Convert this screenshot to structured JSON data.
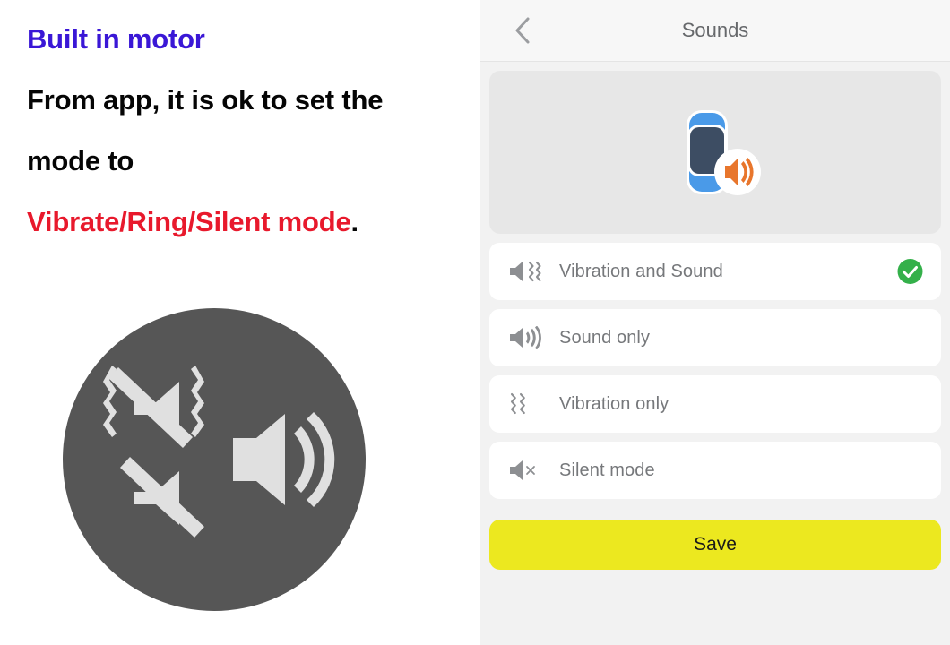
{
  "annotation": {
    "title": "Built in motor",
    "line1": "From app, it is ok to set the",
    "line2": "mode to",
    "line3_red": "Vibrate/Ring/Silent mode",
    "line3_period": ".",
    "title_color": "#3a17d6",
    "red_color": "#e8192c",
    "body_color": "#050505",
    "motor_icon_circle_color": "#565656",
    "motor_icon_glyph_color": "#e0e0e0"
  },
  "phone": {
    "nav": {
      "back_icon": "chevron-left-icon",
      "title": "Sounds"
    },
    "hero": {
      "icon": "smartwatch-with-speaker-icon",
      "watch_band_color": "#4a9ae8",
      "watch_screen_color": "#3d4d63",
      "badge_speaker_color": "#e8762c",
      "card_bg": "#e7e7e7"
    },
    "options": [
      {
        "id": "vibration-and-sound",
        "label": "Vibration and Sound",
        "icon": "speaker-vibrate-icon",
        "selected": true
      },
      {
        "id": "sound-only",
        "label": "Sound only",
        "icon": "speaker-waves-icon",
        "selected": false
      },
      {
        "id": "vibration-only",
        "label": "Vibration only",
        "icon": "vibrate-icon",
        "selected": false
      },
      {
        "id": "silent-mode",
        "label": "Silent mode",
        "icon": "speaker-mute-icon",
        "selected": false
      }
    ],
    "selected_option": "Vibration and Sound",
    "check_color": "#34b04a",
    "save": {
      "label": "Save",
      "bg_color": "#ece81f",
      "text_color": "#1a1a1a"
    },
    "panel_bg": "#f2f2f2",
    "nav_bg": "#f7f7f7"
  }
}
